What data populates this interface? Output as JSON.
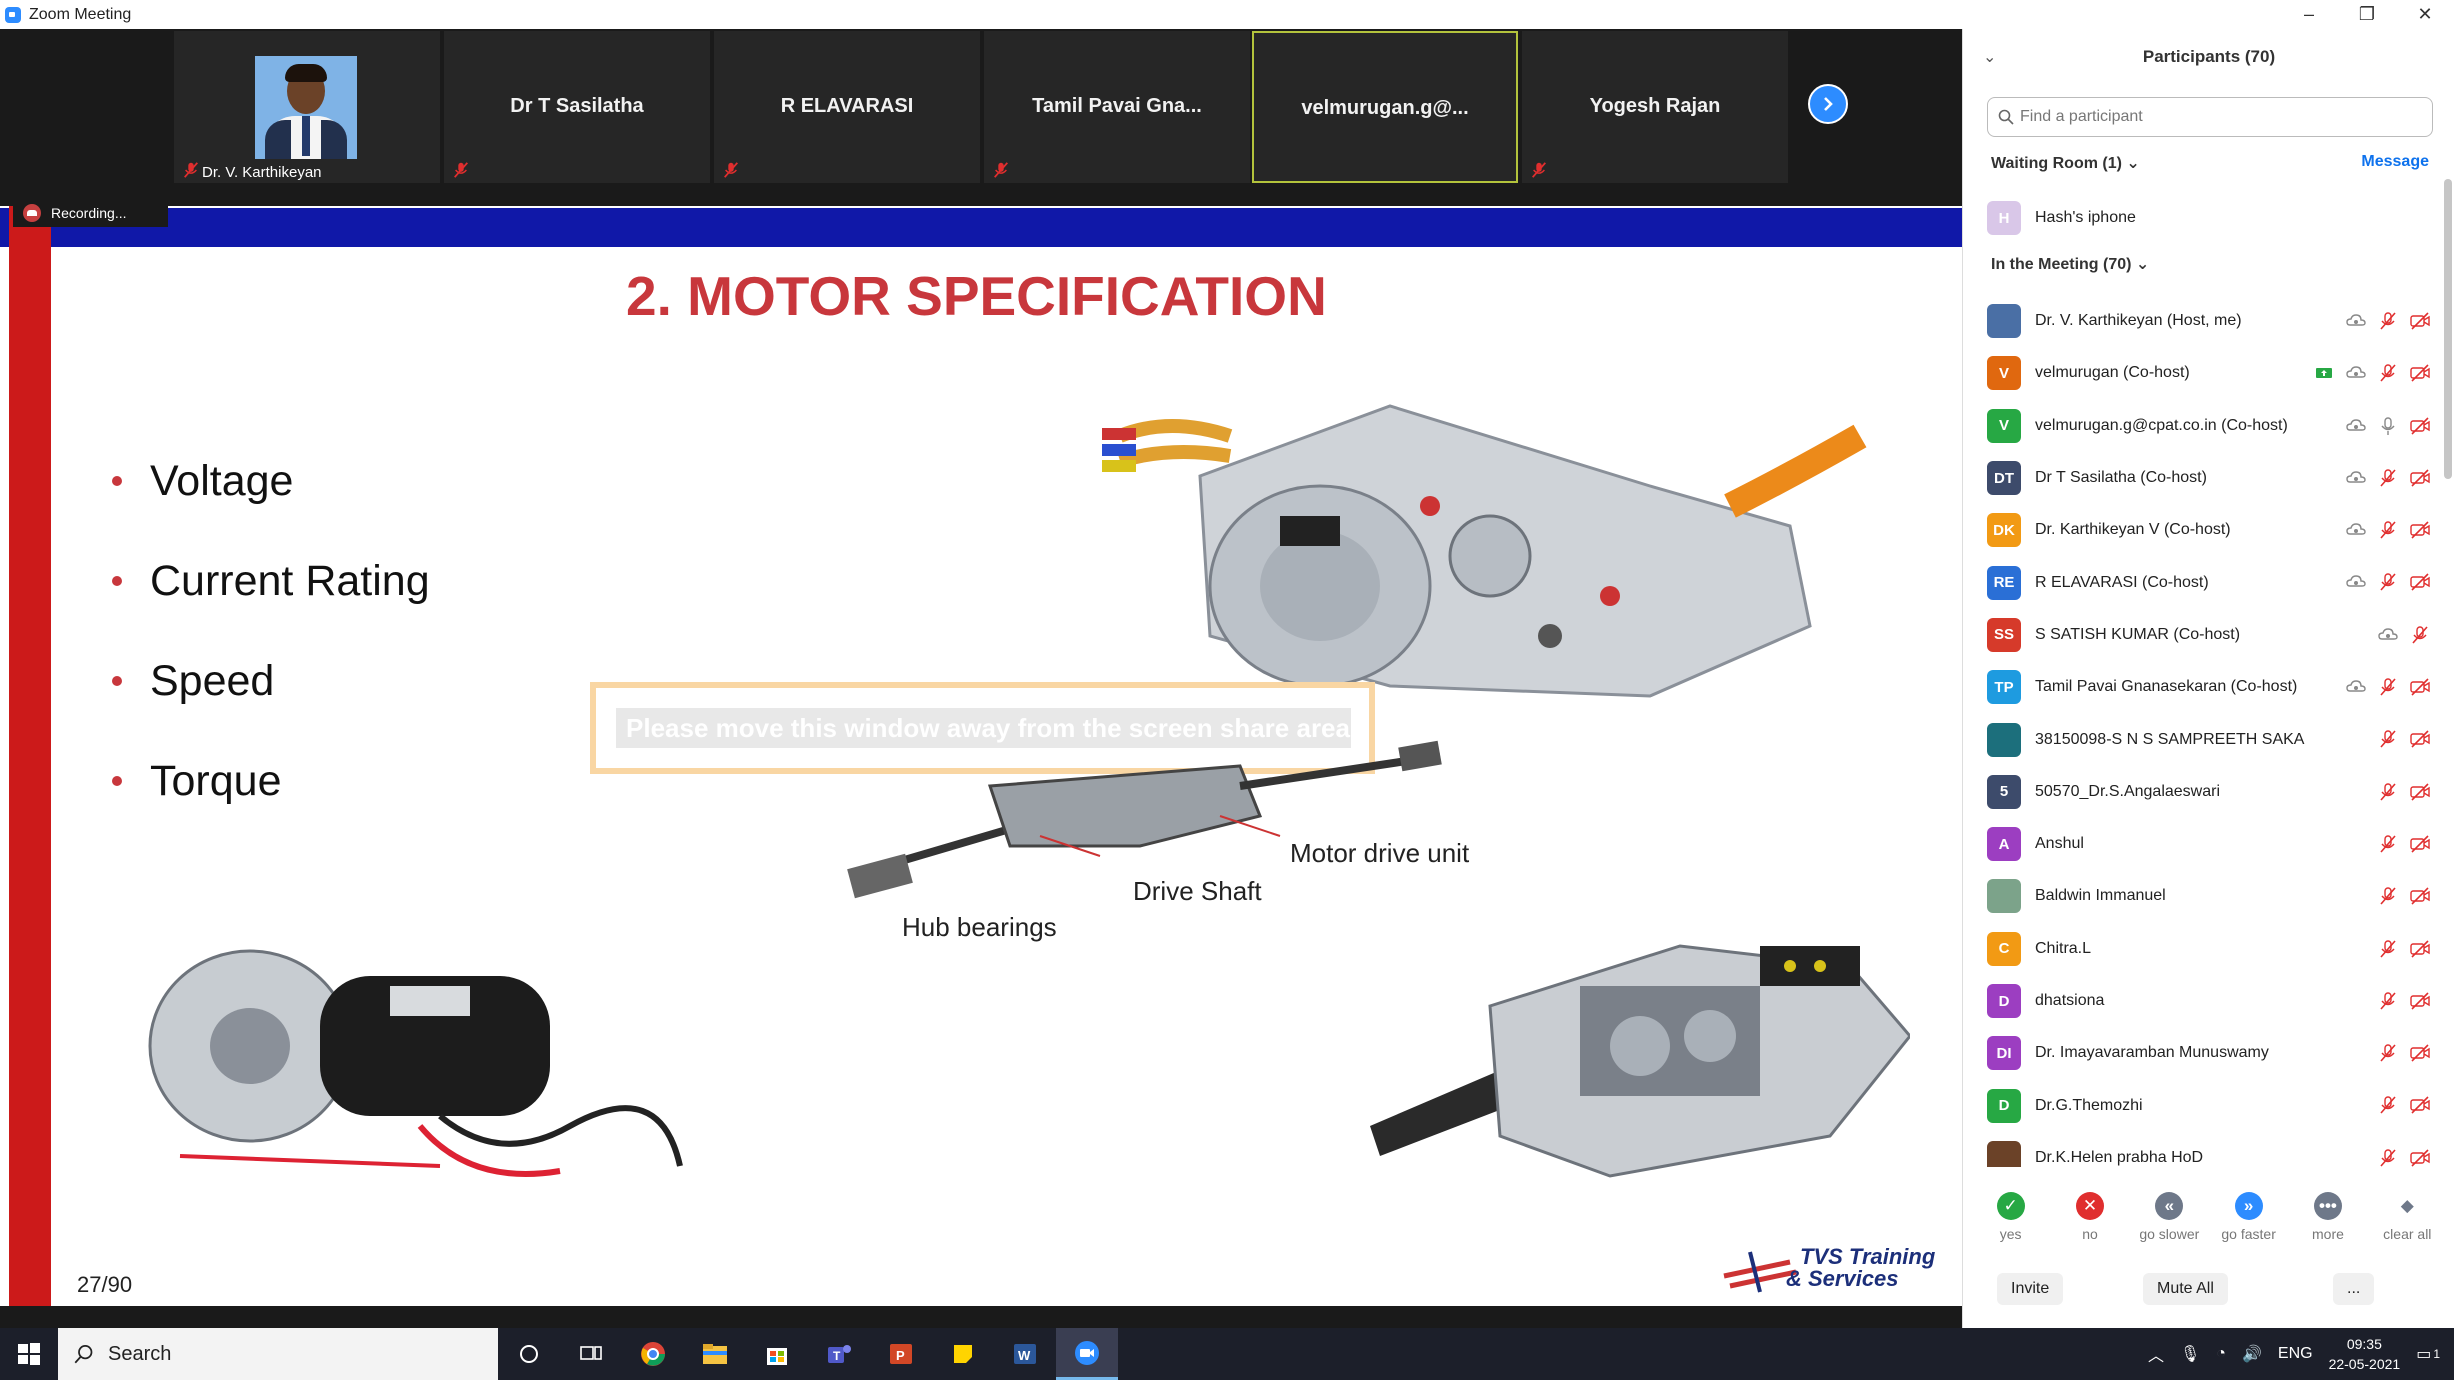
{
  "window": {
    "title": "Zoom Meeting",
    "min": "–",
    "max": "❐",
    "close": "✕"
  },
  "strip": {
    "tiles": [
      {
        "name": "Dr. V. Karthikeyan",
        "photo": true
      },
      {
        "name": "Dr T Sasilatha"
      },
      {
        "name": "R ELAVARASI"
      },
      {
        "name": "Tamil Pavai Gna..."
      },
      {
        "name": "velmurugan.g@..."
      },
      {
        "name": "Yogesh Rajan"
      }
    ],
    "recording": "Recording..."
  },
  "slide": {
    "title": "2. MOTOR SPECIFICATION",
    "bullets": [
      "Voltage",
      "Current Rating",
      "Speed",
      "Torque"
    ],
    "labels": {
      "motor_drive_unit": "Motor drive unit",
      "drive_shaft": "Drive Shaft",
      "hub_bearings": "Hub bearings"
    },
    "overlay_text": "Please move this window away from the screen share area",
    "page": "27/90",
    "logo_line1": "TVS Training",
    "logo_line2": "& Services"
  },
  "panel": {
    "title": "Participants (70)",
    "search_placeholder": "Find a participant",
    "waiting_header": "Waiting Room (1)",
    "message_btn": "Message",
    "waiting": [
      {
        "initials": "H",
        "name": "Hash's iphone",
        "color": "#d9c7e8"
      }
    ],
    "meeting_header": "In the Meeting (70)",
    "participants": [
      {
        "initials": "",
        "name": "Dr. V. Karthikeyan (Host, me)",
        "color": "#4a6fa5",
        "photo": true,
        "icons": [
          "rec",
          "mute",
          "vid"
        ]
      },
      {
        "initials": "V",
        "name": "velmurugan (Co-host)",
        "color": "#e0680f",
        "icons": [
          "share",
          "rec",
          "mute",
          "vid"
        ]
      },
      {
        "initials": "V",
        "name": "velmurugan.g@cpat.co.in (Co-host)",
        "color": "#27a844",
        "icons": [
          "rec",
          "mic",
          "vid"
        ]
      },
      {
        "initials": "DT",
        "name": "Dr T Sasilatha (Co-host)",
        "color": "#3d4b6b",
        "icons": [
          "rec",
          "mute",
          "vid"
        ]
      },
      {
        "initials": "DK",
        "name": "Dr. Karthikeyan V (Co-host)",
        "color": "#f29a14",
        "icons": [
          "rec",
          "mute",
          "vid"
        ]
      },
      {
        "initials": "RE",
        "name": "R ELAVARASI (Co-host)",
        "color": "#2a6fd6",
        "icons": [
          "rec",
          "mute",
          "vid"
        ]
      },
      {
        "initials": "SS",
        "name": "S SATISH KUMAR (Co-host)",
        "color": "#d63a2a",
        "icons": [
          "rec",
          "mute"
        ]
      },
      {
        "initials": "TP",
        "name": "Tamil Pavai Gnanasekaran (Co-host)",
        "color": "#1e9be0",
        "icons": [
          "rec",
          "mute",
          "vid"
        ]
      },
      {
        "initials": "",
        "name": "38150098-S N S SAMPREETH SAKA",
        "color": "#1c6f7c",
        "photo": true,
        "icons": [
          "mute",
          "vid"
        ]
      },
      {
        "initials": "5",
        "name": "50570_Dr.S.Angalaeswari",
        "color": "#3d4b6b",
        "icons": [
          "mute",
          "vid"
        ]
      },
      {
        "initials": "A",
        "name": "Anshul",
        "color": "#9c3ec1",
        "icons": [
          "mute",
          "vid"
        ]
      },
      {
        "initials": "",
        "name": "Baldwin Immanuel",
        "color": "#7ca38a",
        "photo": true,
        "icons": [
          "mute",
          "vid"
        ]
      },
      {
        "initials": "C",
        "name": "Chitra.L",
        "color": "#f29a14",
        "icons": [
          "mute",
          "vid"
        ]
      },
      {
        "initials": "D",
        "name": "dhatsiona",
        "color": "#9c3ec1",
        "icons": [
          "mute",
          "vid"
        ]
      },
      {
        "initials": "DI",
        "name": "Dr. Imayavaramban Munuswamy",
        "color": "#9c3ec1",
        "icons": [
          "mute",
          "vid"
        ]
      },
      {
        "initials": "D",
        "name": "Dr.G.Themozhi",
        "color": "#27a844",
        "icons": [
          "mute",
          "vid"
        ]
      },
      {
        "initials": "",
        "name": "Dr.K.Helen prabha HoD",
        "color": "#6b4228",
        "photo": true,
        "icons": [
          "mute",
          "vid"
        ]
      }
    ],
    "reactions": [
      {
        "label": "yes",
        "glyph": "✓",
        "color": "#27a844"
      },
      {
        "label": "no",
        "glyph": "✕",
        "color": "#e02e2e"
      },
      {
        "label": "go slower",
        "glyph": "«",
        "color": "#6e7889"
      },
      {
        "label": "go faster",
        "glyph": "»",
        "color": "#2d8cff"
      },
      {
        "label": "more",
        "glyph": "•••",
        "color": "#6e7889"
      },
      {
        "label": "clear all",
        "glyph": "◆",
        "color": "#6e7889"
      }
    ],
    "invite": "Invite",
    "mute_all": "Mute All",
    "more": "..."
  },
  "taskbar": {
    "search": "Search",
    "lang": "ENG",
    "time": "09:35",
    "date": "22-05-2021",
    "notif": "1"
  }
}
